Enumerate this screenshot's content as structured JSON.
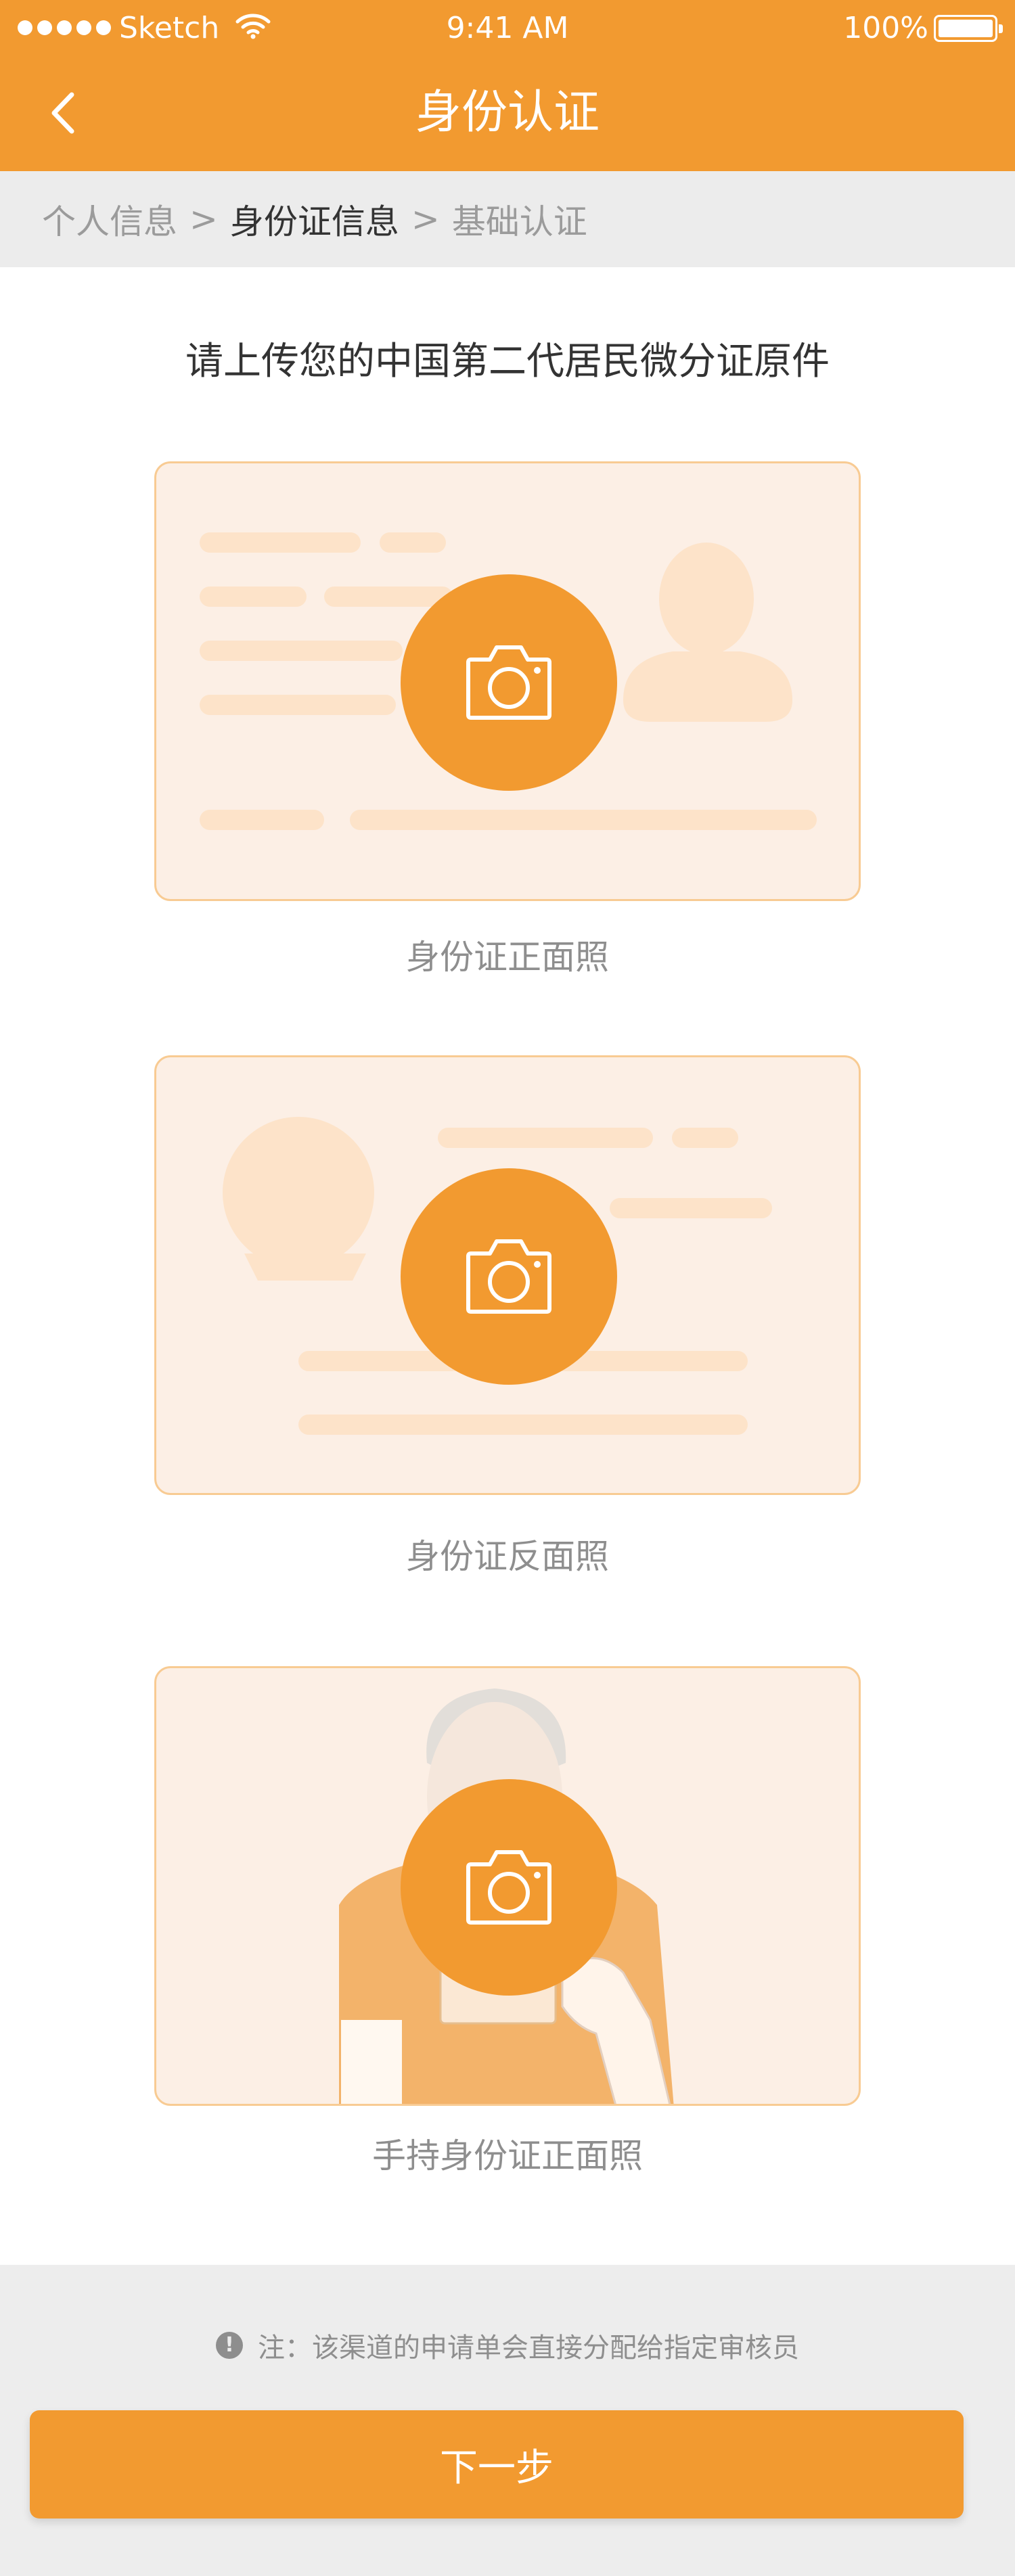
{
  "status_bar": {
    "carrier": "Sketch",
    "time": "9:41 AM",
    "battery": "100%"
  },
  "nav": {
    "title": "身份认证",
    "back_icon": "chevron-left-icon"
  },
  "breadcrumb": {
    "steps": [
      "个人信息",
      "身份证信息",
      "基础认证"
    ],
    "separator": ">",
    "active_index": 1
  },
  "main": {
    "heading": "请上传您的中国第二代居民微分证原件",
    "uploads": [
      {
        "caption": "身份证正面照",
        "icon": "camera-icon"
      },
      {
        "caption": "身份证反面照",
        "icon": "camera-icon"
      },
      {
        "caption": "手持身份证正面照",
        "icon": "camera-icon"
      }
    ]
  },
  "footer": {
    "note": "注：该渠道的申请单会直接分配给指定审核员",
    "note_icon": "!",
    "next_label": "下一步"
  },
  "colors": {
    "accent": "#F29A30",
    "card_bg": "#FCEFE5",
    "card_border": "#F8CB93",
    "placeholder": "#FDE3C9"
  }
}
